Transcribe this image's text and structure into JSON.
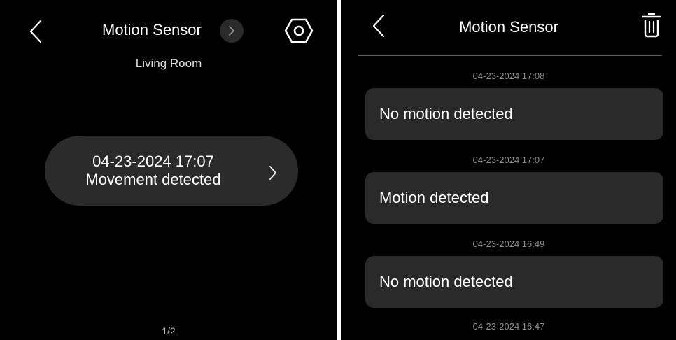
{
  "left": {
    "title": "Motion Sensor",
    "room": "Living Room",
    "status_card": {
      "timestamp": "04-23-2024 17:07",
      "message": "Movement detected"
    },
    "page_indicator": "1/2"
  },
  "right": {
    "title": "Motion Sensor",
    "log": [
      {
        "time": "04-23-2024 17:08",
        "label": "No motion detected"
      },
      {
        "time": "04-23-2024 17:07",
        "label": "Motion detected"
      },
      {
        "time": "04-23-2024 16:49",
        "label": "No motion detected"
      },
      {
        "time": "04-23-2024 16:47",
        "label": ""
      }
    ]
  },
  "icons": {
    "back": "chevron-left-icon",
    "details": "chevron-right-icon",
    "settings": "hexagon-settings-icon",
    "delete": "trash-icon"
  },
  "colors": {
    "background": "#000000",
    "card": "#2b2b2b",
    "muted_text": "#8d8d8d"
  }
}
